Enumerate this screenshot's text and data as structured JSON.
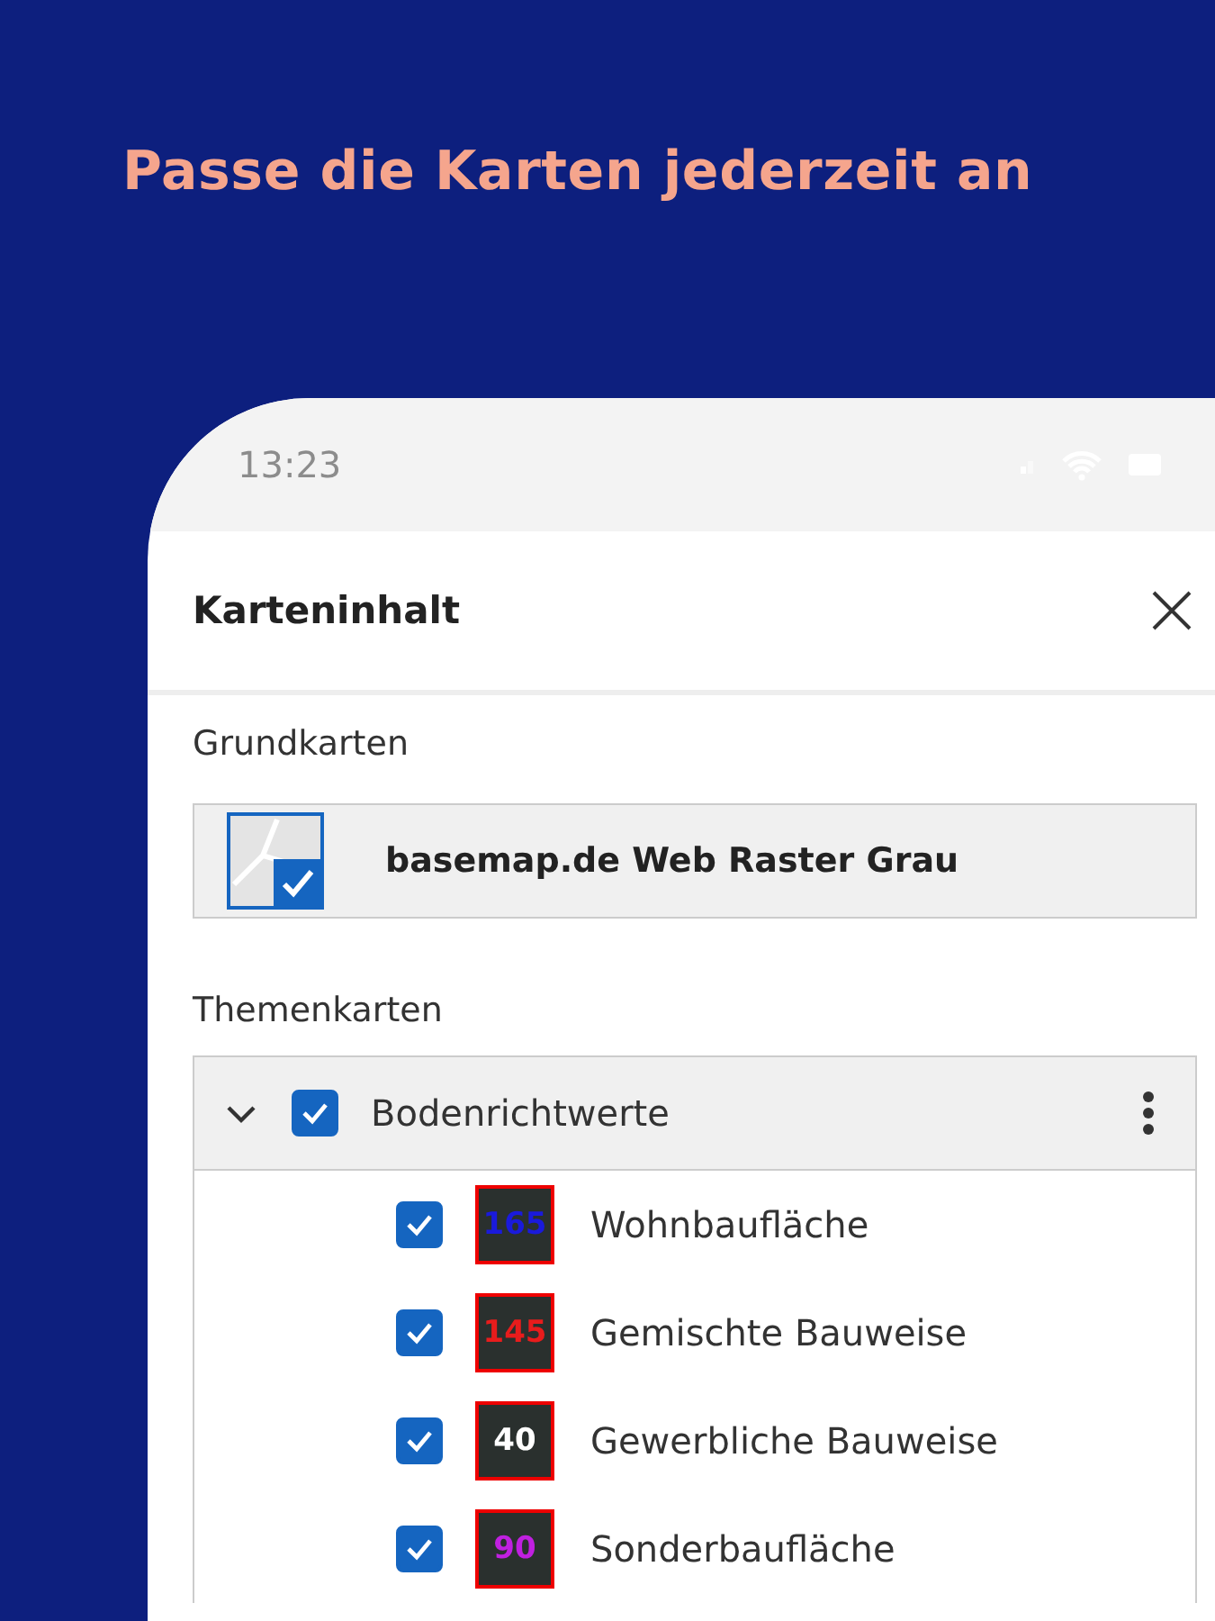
{
  "headline": "Passe die Karten jederzeit an",
  "status_bar": {
    "time": "13:23"
  },
  "panel": {
    "title": "Karteninhalt"
  },
  "base_section": {
    "label": "Grundkarten",
    "layer": {
      "name": "basemap.de Web Raster Grau",
      "selected": true
    }
  },
  "theme_section": {
    "label": "Themenkarten",
    "group": {
      "name": "Bodenrichtwerte",
      "expanded": true,
      "checked": true,
      "items": [
        {
          "name": "Wohnbaufläche",
          "value": "165",
          "color": "#1a1adc",
          "checked": true
        },
        {
          "name": "Gemischte Bauweise",
          "value": "145",
          "color": "#e81c1c",
          "checked": true
        },
        {
          "name": "Gewerbliche Bauweise",
          "value": "40",
          "color": "#ffffff",
          "checked": true
        },
        {
          "name": "Sonderbaufläche",
          "value": "90",
          "color": "#c020e0",
          "checked": true
        }
      ]
    }
  }
}
